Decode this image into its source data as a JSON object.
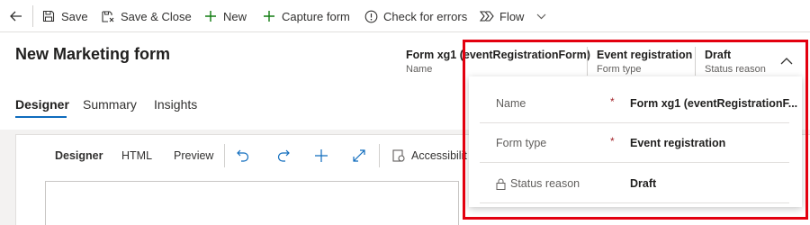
{
  "command_bar": {
    "save": "Save",
    "save_close": "Save & Close",
    "new": "New",
    "capture_form": "Capture form",
    "check_errors": "Check for errors",
    "flow": "Flow"
  },
  "header": {
    "title": "New Marketing form",
    "fields": [
      {
        "value": "Form xg1 (eventRegistrationForm)",
        "label": "Name"
      },
      {
        "value": "Event registration",
        "label": "Form type"
      },
      {
        "value": "Draft",
        "label": "Status reason"
      }
    ]
  },
  "tabs": [
    "Designer",
    "Summary",
    "Insights"
  ],
  "designer_toolbar": {
    "designer": "Designer",
    "html": "HTML",
    "preview": "Preview",
    "accessibility": "Accessibilit"
  },
  "flyout": {
    "rows": [
      {
        "label": "Name",
        "required": "*",
        "value": "Form xg1 (eventRegistrationF..."
      },
      {
        "label": "Form type",
        "required": "*",
        "value": "Event registration"
      },
      {
        "label": "Status reason",
        "required": "",
        "value": "Draft"
      }
    ]
  },
  "colors": {
    "accent": "#0f6cbd",
    "green_icon": "#107c10",
    "highlight": "#e3000f",
    "required": "#a4262c"
  }
}
